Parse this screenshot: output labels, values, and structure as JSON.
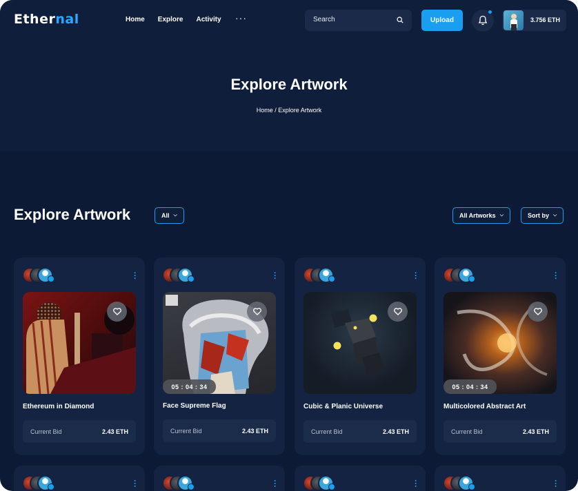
{
  "header": {
    "logo_main": "Ether",
    "logo_accent": "nal",
    "nav": [
      "Home",
      "Explore",
      "Activity"
    ],
    "more": "···",
    "search_placeholder": "Search",
    "upload_label": "Upload",
    "balance": "3.756 ETH"
  },
  "banner": {
    "title": "Explore Artwork",
    "breadcrumb": "Home / Explore Artwork"
  },
  "section": {
    "title": "Explore Artwork",
    "filter_all": "All",
    "filter_artworks": "All Artworks",
    "sort_by": "Sort by"
  },
  "cards": [
    {
      "title": "Ethereum in Diamond",
      "timer": "",
      "bid_label": "Current Bid",
      "bid_value": "2.43 ETH"
    },
    {
      "title": "Face Supreme Flag",
      "timer": "05 : 04 : 34",
      "bid_label": "Current Bid",
      "bid_value": "2.43 ETH"
    },
    {
      "title": "Cubic & Planic Universe",
      "timer": "",
      "bid_label": "Current Bid",
      "bid_value": "2.43 ETH"
    },
    {
      "title": "Multicolored Abstract Art",
      "timer": "05 : 04 : 34",
      "bid_label": "Current Bid",
      "bid_value": "2.43 ETH"
    }
  ],
  "colors": {
    "background": "#0c1a35",
    "card": "#132341",
    "accent": "#1a9ff0"
  }
}
